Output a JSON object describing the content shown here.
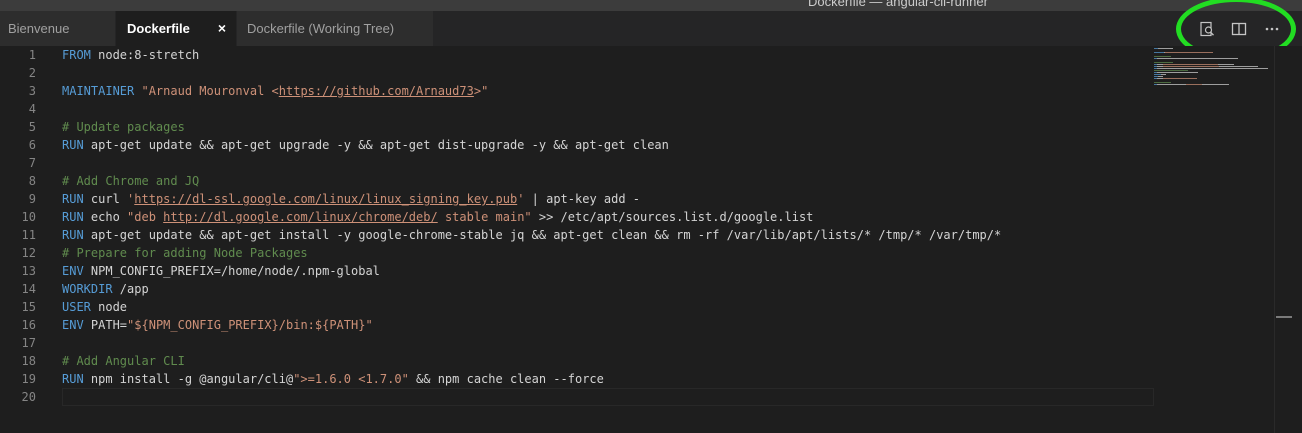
{
  "window": {
    "title": "Dockerfile — angular-cli-runner"
  },
  "tabs": [
    {
      "label": "Bienvenue"
    },
    {
      "label": "Dockerfile",
      "close": "×"
    },
    {
      "label": "Dockerfile (Working Tree)"
    }
  ],
  "actions": [
    {
      "icon": "open-changes-icon"
    },
    {
      "icon": "split-editor-icon"
    },
    {
      "icon": "more-actions-icon"
    }
  ],
  "annotation": {
    "color": "#22dd22"
  },
  "editor": {
    "lines": [
      {
        "n": "1",
        "tokens": [
          {
            "c": "kw",
            "t": "FROM"
          },
          {
            "c": "",
            "t": " node:8-stretch"
          }
        ]
      },
      {
        "n": "2",
        "tokens": []
      },
      {
        "n": "3",
        "tokens": [
          {
            "c": "kw",
            "t": "MAINTAINER"
          },
          {
            "c": "",
            "t": " "
          },
          {
            "c": "str",
            "t": "\"Arnaud Mouronval <"
          },
          {
            "c": "url",
            "t": "https://github.com/Arnaud73"
          },
          {
            "c": "str",
            "t": ">\""
          }
        ]
      },
      {
        "n": "4",
        "tokens": []
      },
      {
        "n": "5",
        "tokens": [
          {
            "c": "cm",
            "t": "# Update packages"
          }
        ]
      },
      {
        "n": "6",
        "tokens": [
          {
            "c": "kw",
            "t": "RUN"
          },
          {
            "c": "",
            "t": " apt-get update && apt-get upgrade -y && apt-get dist-upgrade -y && apt-get clean"
          }
        ]
      },
      {
        "n": "7",
        "tokens": []
      },
      {
        "n": "8",
        "tokens": [
          {
            "c": "cm",
            "t": "# Add Chrome and JQ"
          }
        ]
      },
      {
        "n": "9",
        "tokens": [
          {
            "c": "kw",
            "t": "RUN"
          },
          {
            "c": "",
            "t": " curl "
          },
          {
            "c": "str",
            "t": "'"
          },
          {
            "c": "url",
            "t": "https://dl-ssl.google.com/linux/linux_signing_key.pub"
          },
          {
            "c": "str",
            "t": "'"
          },
          {
            "c": "",
            "t": " | apt-key add -"
          }
        ]
      },
      {
        "n": "10",
        "tokens": [
          {
            "c": "kw",
            "t": "RUN"
          },
          {
            "c": "",
            "t": " echo "
          },
          {
            "c": "str",
            "t": "\"deb "
          },
          {
            "c": "url",
            "t": "http://dl.google.com/linux/chrome/deb/"
          },
          {
            "c": "str",
            "t": " stable main\""
          },
          {
            "c": "",
            "t": " >> /etc/apt/sources.list.d/google.list"
          }
        ]
      },
      {
        "n": "11",
        "tokens": [
          {
            "c": "kw",
            "t": "RUN"
          },
          {
            "c": "",
            "t": " apt-get update && apt-get install -y google-chrome-stable jq && apt-get clean && rm -rf /var/lib/apt/lists/* /tmp/* /var/tmp/*"
          }
        ]
      },
      {
        "n": "12",
        "tokens": [
          {
            "c": "cm",
            "t": "# Prepare for adding Node Packages"
          }
        ]
      },
      {
        "n": "13",
        "tokens": [
          {
            "c": "kw",
            "t": "ENV"
          },
          {
            "c": "",
            "t": " NPM_CONFIG_PREFIX=/home/node/.npm-global"
          }
        ]
      },
      {
        "n": "14",
        "tokens": [
          {
            "c": "kw",
            "t": "WORKDIR"
          },
          {
            "c": "",
            "t": " /app"
          }
        ]
      },
      {
        "n": "15",
        "tokens": [
          {
            "c": "kw",
            "t": "USER"
          },
          {
            "c": "",
            "t": " node"
          }
        ]
      },
      {
        "n": "16",
        "tokens": [
          {
            "c": "kw",
            "t": "ENV"
          },
          {
            "c": "",
            "t": " PATH="
          },
          {
            "c": "str",
            "t": "\"${NPM_CONFIG_PREFIX}/bin:${PATH}\""
          }
        ]
      },
      {
        "n": "17",
        "tokens": []
      },
      {
        "n": "18",
        "tokens": [
          {
            "c": "cm",
            "t": "# Add Angular CLI"
          }
        ]
      },
      {
        "n": "19",
        "tokens": [
          {
            "c": "kw",
            "t": "RUN"
          },
          {
            "c": "",
            "t": " npm install -g @angular/cli@"
          },
          {
            "c": "str",
            "t": "\">=1.6.0 <1.7.0\""
          },
          {
            "c": "",
            "t": " && npm cache clean --force"
          }
        ]
      },
      {
        "n": "20",
        "tokens": []
      }
    ]
  },
  "colors": {
    "keyword": "#569cd6",
    "string": "#ce9178",
    "comment": "#608b4e",
    "text": "#d4d4d4",
    "line_number": "#858585",
    "background": "#1e1e1e"
  }
}
